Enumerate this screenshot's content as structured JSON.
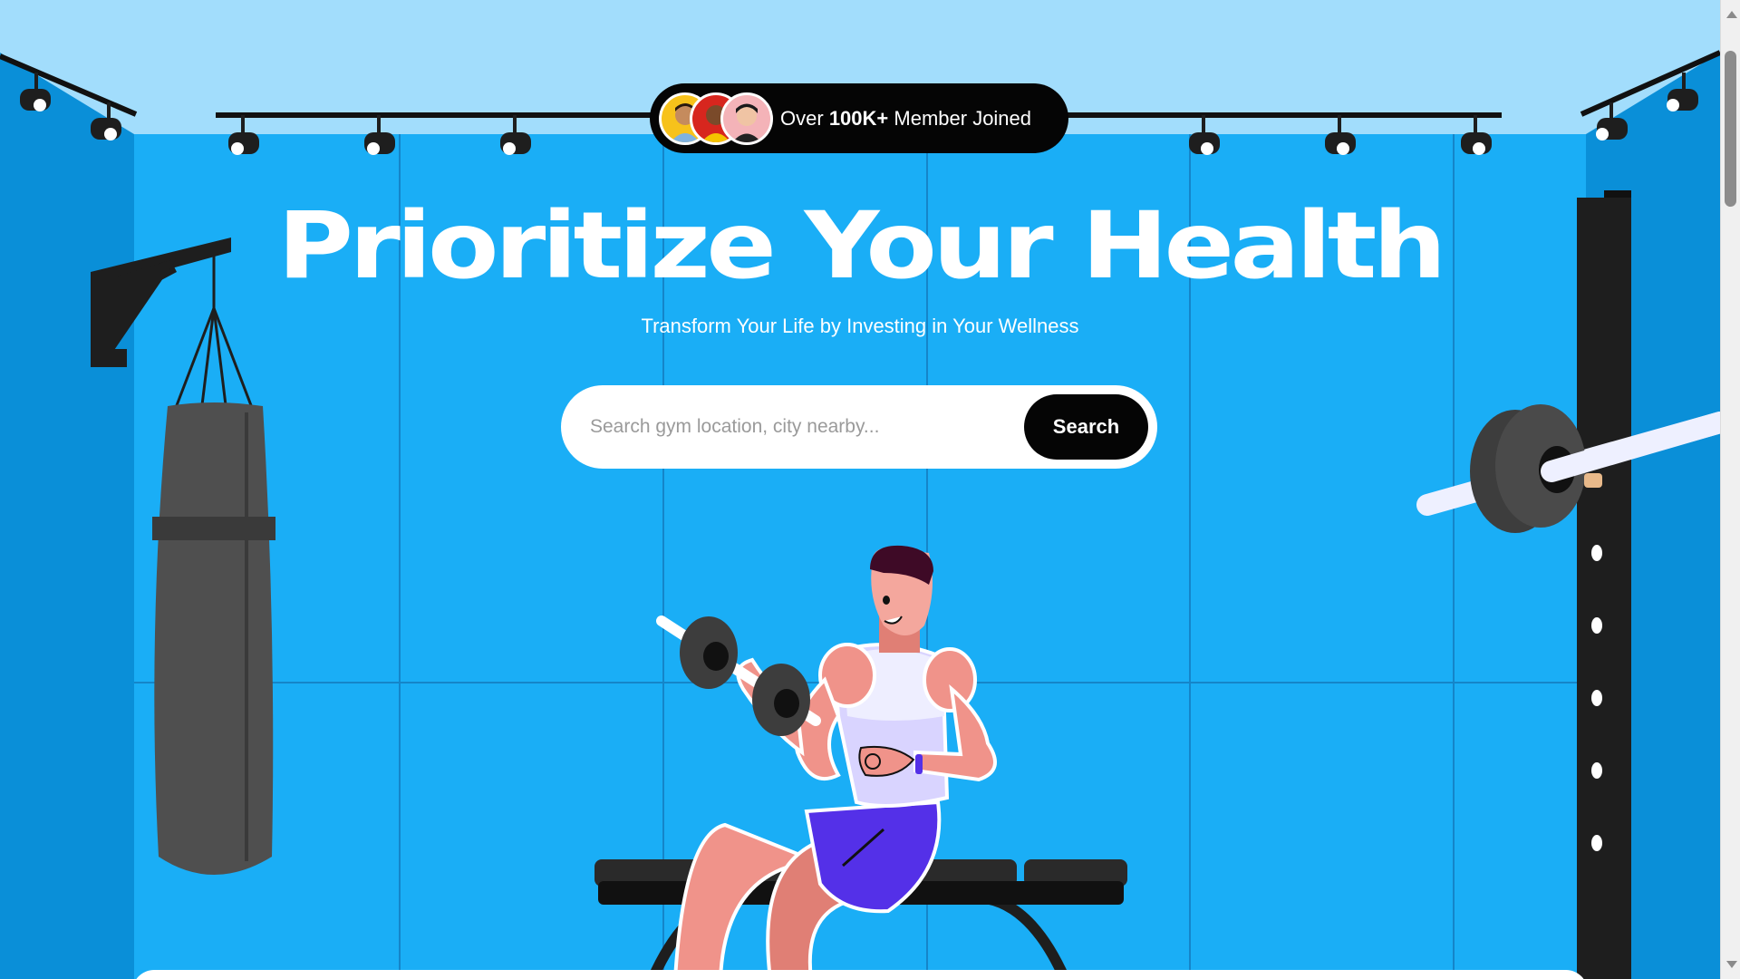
{
  "badge": {
    "prefix": "Over",
    "count": "100K+",
    "suffix": "Member Joined",
    "avatars": [
      "member-avatar-1",
      "member-avatar-2",
      "member-avatar-3"
    ]
  },
  "hero": {
    "title": "Prioritize Your Health",
    "subtitle": "Transform Your Life by Investing in Your Wellness"
  },
  "search": {
    "placeholder": "Search gym location, city nearby...",
    "value": "",
    "button_label": "Search"
  },
  "colors": {
    "sky": "#a2ddfc",
    "wall": "#1aaef6",
    "side_wall": "#0a8fd8",
    "badge_bg": "#050505",
    "button_bg": "#050505",
    "shorts": "#5430e8"
  },
  "icons": [
    "scroll-up-icon",
    "scroll-down-icon"
  ]
}
